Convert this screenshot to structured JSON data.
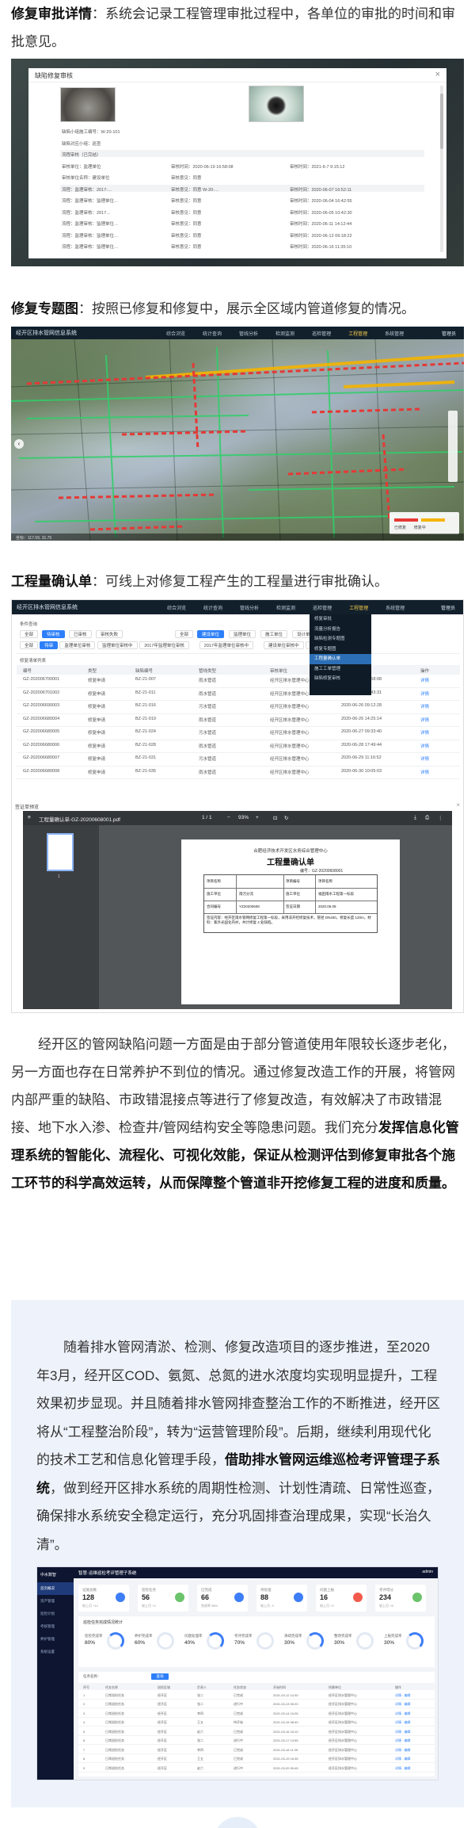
{
  "sections": {
    "repair_approval": {
      "heading": "修复审批详情",
      "text": "：系统会记录工程管理审批过程中，各单位的审批的时间和审批意见。"
    },
    "repair_map": {
      "heading": "修复专题图",
      "text": "：按照已修复和修复中，展示全区域内管道修复的情况。"
    },
    "workload": {
      "heading": "工程量确认单",
      "text": "：可线上对修复工程产生的工程量进行审批确认。"
    }
  },
  "approval_dialog": {
    "title": "缺陷修复审核",
    "rows": [
      {
        "a": "缺陷小组施工编号：W-20-101"
      },
      {
        "a": "缺陷对应小组：巡查"
      },
      {
        "a": "流程审核（已完结）"
      },
      {
        "a": "审核单位：监理单位",
        "b": "审核时间：2020-06-19 16:58:08",
        "c": "审核时间：2021-6-7 9:15:12"
      },
      {
        "a": "审核单位名称：建设单位",
        "b": "审核意见：同意"
      },
      {
        "a": "流程：监理审核：2017-…",
        "b": "审核意见：同意 W-20-…",
        "c": "审核时间：2020-06-07 16:52:11"
      },
      {
        "a": "流程：监理审核：监理单位…",
        "b": "审核意见：同意",
        "c": "审核时间：2020-06-04 16:42:55"
      },
      {
        "a": "流程：监理审核：2017…",
        "b": "审核意见：同意",
        "c": "审核时间：2020-06-05 10:42:30"
      },
      {
        "a": "流程：监理审核：监理单位…",
        "b": "审核意见：同意",
        "c": "审核时间：2020-06-11 14:12:44"
      },
      {
        "a": "流程：监理审核：监理单位…",
        "b": "审核意见：同意",
        "c": "审核时间：2020-06-12 09:18:22"
      },
      {
        "a": "流程：监理审核：监理单位…",
        "b": "审核意见：同意",
        "c": "审核时间：2020-06-16 11:35:10"
      }
    ]
  },
  "map_app": {
    "system_name": "经开区排水管网信息系统",
    "menus": [
      "综合浏览",
      "统计查询",
      "管线分析",
      "检测监测",
      "巡检管理",
      "工程管理",
      "系统管理"
    ],
    "active_menu": "工程管理",
    "user": "管理员",
    "legend": [
      "已修复",
      "修复中"
    ],
    "status": "坐标：117.09, 31.75"
  },
  "workload_app": {
    "system_name": "经开区排水管网信息系统",
    "menus": [
      "综合浏览",
      "统计查询",
      "管线分析",
      "检测监测",
      "巡检管理",
      "工程管理",
      "系统管理"
    ],
    "user": "管理员",
    "dropdown": [
      "修复审批",
      "流量分析报告",
      "缺陷检测专题图",
      "修复专题图",
      "工程量确认单",
      "施工工单管理",
      "缺陷修复审核"
    ],
    "dropdown_selected": 4,
    "filter_label": "条件查询",
    "tabs_a": [
      "全部",
      "待审核",
      "已审核",
      "审核失败"
    ],
    "tabs_a_active": 1,
    "tabs_b": [
      "全部",
      "建设单位",
      "监理单位",
      "施工单位",
      "设计单位"
    ],
    "tabs_b_active": 1,
    "tabs_c": [
      "全部",
      "待审",
      "监理单位审核",
      "监理单位审核中",
      "2017年监理单位审核",
      "2017年监理单位审核中",
      "建设单位审核中",
      "建设单位审核完成"
    ],
    "tabs_c_active": 1,
    "list_label": "修复清单列表",
    "columns": [
      "编号",
      "类型",
      "缺陷编号",
      "管线类型",
      "审核单位",
      "审核时间",
      "操作"
    ],
    "rows": [
      [
        "GZ-202006700001",
        "修复申请",
        "BZ-21-007",
        "雨水管道",
        "经开区排水管理中心",
        "2020-06-18 16:58:08",
        "详情"
      ],
      [
        "GZ-202006701002",
        "修复申请",
        "BZ-21-011",
        "雨水管道",
        "经开区排水管理中心",
        "2020-06-23 10:43:31",
        "详情"
      ],
      [
        "GZ-202006690003",
        "修复申请",
        "BZ-21-016",
        "污水管道",
        "经开区排水管理中心",
        "2020-06-26 09:12:28",
        "详情"
      ],
      [
        "GZ-202006680004",
        "修复申请",
        "BZ-21-019",
        "雨水管道",
        "经开区排水管理中心",
        "2020-06-26 14:25:14",
        "详情"
      ],
      [
        "GZ-202006680005",
        "修复申请",
        "BZ-21-024",
        "污水管道",
        "经开区排水管理中心",
        "2020-06-27 09:33:40",
        "详情"
      ],
      [
        "GZ-202006680006",
        "修复申请",
        "BZ-21-028",
        "雨水管道",
        "经开区排水管理中心",
        "2020-06-28 17:49:44",
        "详情"
      ],
      [
        "GZ-202006680007",
        "修复申请",
        "BZ-21-031",
        "污水管道",
        "经开区排水管理中心",
        "2020-06-29 11:16:52",
        "详情"
      ],
      [
        "GZ-202006680008",
        "修复申请",
        "BZ-21-035",
        "雨水管道",
        "经开区排水管理中心",
        "2020-06-30 10:05:03",
        "详情"
      ]
    ],
    "confirm_title": "签证单预览",
    "pdf": {
      "filename": "工程量确认单-GZ-20200608001.pdf",
      "page": "1 / 1",
      "zoom": "93%",
      "page_number": "1",
      "doc_org": "合肥经济技术开发区水务综合管理中心",
      "doc_title": "工程量确认单",
      "doc_no": "编号：GZ-20200608001",
      "grid": [
        [
          "项目名称",
          "",
          "项目编号",
          "项目名称"
        ],
        [
          "施工单位",
          "雨污分流",
          "施工单位",
          "福田雨水工程第一标段"
        ],
        [
          "合同编号",
          "YZ20200608",
          "签证日期",
          "2020.06.08"
        ],
        [
          "签证内容：经开区雨水管网修复工程第一标段，采用非开挖修复技术，管径 DN400，修复长度 120m，材料：紫外光固化内衬，共计修复 4 处缺陷。"
        ]
      ]
    }
  },
  "body": {
    "p1_pre": "经开区的管网缺陷问题一方面是由于部分管道使用年限较长逐步老化，另一方面也存在日常养护不到位的情况。通过修复改造工作的开展，将管网内部严重的缺陷、市政错混接点等进行了修复改造，有效解决了市政错混接、地下水入渗、检查井/管网结构安全等隐患问题。我们充分",
    "p1_bold": "发挥信息化管理系统的智能化、流程化、可视化效能，保证从检测评估到修复审批各个施工环节的科学高效运转，从而保障整个管道非开挖修复工程的进度和质量。"
  },
  "quote": {
    "pre": "随着排水管网清淤、检测、修复改造项目的逐步推进，至2020年3月，经开区COD、氨氮、总氮的进水浓度均实现明显提升，工程效果初步显现。并且随着排水管网排查整治工作的不断推进，经开区将从“工程整治阶段”，转为“运营管理阶段”。后期，继续利用现代化的技术工艺和信息化管理手段，",
    "bold": "借助排水管网运维巡检考评管理子系统",
    "post": "，做到经开区排水系统的周期性检测、计划性清疏、日常性巡查，确保排水系统安全稳定运行，充分巩固排查治理成果，实现“长治久清”。"
  },
  "dashboard": {
    "logo": "中水数智",
    "title": "智慧·运维巡检考评管理子系统",
    "user": "admin",
    "nav": [
      "首页概况",
      "资产管理",
      "巡检计划",
      "考核管理",
      "养护管理",
      "系统设置"
    ],
    "nav_active": 0,
    "cards": [
      {
        "label": "设施总数",
        "value": "128",
        "sub": "较上月 +12",
        "color": "#3d7df6"
      },
      {
        "label": "巡检任务",
        "value": "56",
        "sub": "较上月 +4",
        "color": "#6bc36b"
      },
      {
        "label": "已完成",
        "value": "66",
        "sub": "完成率 98%",
        "color": "#3d7df6"
      },
      {
        "label": "待处理",
        "value": "88",
        "sub": "较上月 -3",
        "color": "#3d7df6"
      },
      {
        "label": "问题上报",
        "value": "16",
        "sub": "较上月 +2",
        "color": "#f25b4c"
      },
      {
        "label": "考评得分",
        "value": "234",
        "sub": "较上月 +8",
        "color": "#6bc36b"
      }
    ],
    "panel_title": "巡检任务完成情况统计",
    "donuts": [
      {
        "label": "巡检完成率",
        "value": "80%",
        "hi": true
      },
      {
        "label": "养护完成率",
        "value": "60%",
        "hi": false
      },
      {
        "label": "问题处理率",
        "value": "40%",
        "hi": true
      },
      {
        "label": "考评完成率",
        "value": "70%",
        "hi": false
      },
      {
        "label": "清疏完成率",
        "value": "30%",
        "hi": true
      },
      {
        "label": "整改完成率",
        "value": "30%",
        "hi": false
      },
      {
        "label": "上报完成率",
        "value": "30%",
        "hi": true
      }
    ],
    "search_label": "任务名称：",
    "search_button": "查询",
    "columns": [
      "序号",
      "任务名称",
      "巡检区域",
      "负责人",
      "任务状态",
      "开始时间",
      "所属单位",
      "操作"
    ],
    "rows": [
      [
        "1",
        "日常巡检任务",
        "经开区",
        "张二",
        "已完成",
        "2021-03-12 14:30",
        "经开区排水管理中心",
        "详情 · 编辑"
      ],
      [
        "2",
        "日常巡检任务",
        "经开区",
        "张二",
        "进行中",
        "2021-03-13 09:20",
        "经开区排水管理中心",
        "详情 · 编辑"
      ],
      [
        "3",
        "日常巡检任务",
        "经开区",
        "李四",
        "已完成",
        "2021-03-14 10:05",
        "经开区排水管理中心",
        "详情 · 编辑"
      ],
      [
        "4",
        "日常巡检任务",
        "经开区",
        "王五",
        "待开始",
        "2021-03-15 08:40",
        "经开区排水管理中心",
        "详情 · 编辑"
      ],
      [
        "5",
        "日常巡检任务",
        "经开区",
        "赵六",
        "已完成",
        "2021-03-16 15:10",
        "经开区排水管理中心",
        "详情 · 编辑"
      ],
      [
        "6",
        "日常巡检任务",
        "经开区",
        "张二",
        "进行中",
        "2021-03-17 13:55",
        "经开区排水管理中心",
        "详情 · 编辑"
      ],
      [
        "7",
        "日常巡检任务",
        "经开区",
        "李四",
        "已完成",
        "2021-03-18 11:25",
        "经开区排水管理中心",
        "详情 · 编辑"
      ],
      [
        "8",
        "日常巡检任务",
        "经开区",
        "王五",
        "已完成",
        "2021-03-19 16:35",
        "经开区排水管理中心",
        "详情 · 编辑"
      ],
      [
        "9",
        "日常巡检任务",
        "经开区",
        "赵六",
        "进行中",
        "2021-03-20 09:45",
        "经开区排水管理中心",
        "详情 · 编辑"
      ]
    ]
  }
}
